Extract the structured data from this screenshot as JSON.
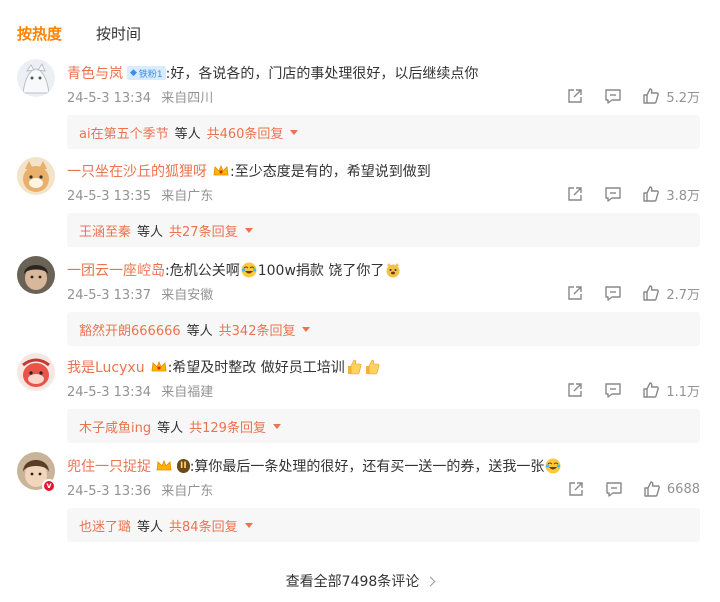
{
  "tabs": [
    {
      "label": "按热度",
      "active": true
    },
    {
      "label": "按时间",
      "active": false
    }
  ],
  "colors": {
    "accent": "#ff8200",
    "username": "#eb7350",
    "meta": "#939393",
    "reply_bg": "#f7f7f7"
  },
  "comments": [
    {
      "user": "青色与岚",
      "badge": "铁粉1",
      "content": ":好，各说各的，门店的事处理很好，以后继续点你",
      "date": "24-5-3 13:34",
      "location": "来自四川",
      "likes": "5.2万",
      "reply_user": "ai在第五个季节",
      "reply_etc": "等人",
      "reply_count": "共460条回复"
    },
    {
      "user": "一只坐在沙丘的狐狸呀",
      "content": ":至少态度是有的，希望说到做到",
      "date": "24-5-3 13:35",
      "location": "来自广东",
      "likes": "3.8万",
      "reply_user": "王涵至秦",
      "reply_etc": "等人",
      "reply_count": "共27条回复"
    },
    {
      "user": "一团云一座崆岛",
      "content_a": ":危机公关啊",
      "content_b": " 100w捐款 饶了你了",
      "date": "24-5-3 13:37",
      "location": "来自安徽",
      "likes": "2.7万",
      "reply_user": "豁然开朗666666",
      "reply_etc": "等人",
      "reply_count": "共342条回复"
    },
    {
      "user": "我是Lucyxu",
      "content": ":希望及时整改 做好员工培训",
      "date": "24-5-3 13:34",
      "location": "来自福建",
      "likes": "1.1万",
      "reply_user": "木子咸鱼ing",
      "reply_etc": "等人",
      "reply_count": "共129条回复"
    },
    {
      "user": "兜住一只捉捉",
      "level_badge": "II",
      "content": ":算你最后一条处理的很好，还有买一送一的券，送我一张",
      "date": "24-5-3 13:36",
      "location": "来自广东",
      "likes": "6688",
      "reply_user": "也迷了璐",
      "reply_etc": "等人",
      "reply_count": "共84条回复"
    }
  ],
  "view_all": "查看全部7498条评论",
  "icons": [
    "share-icon",
    "comment-icon",
    "like-icon",
    "chevron-right-icon",
    "crown-icon",
    "laughing-cry-emoji",
    "thumbs-up-emoji",
    "dog-emoji"
  ]
}
